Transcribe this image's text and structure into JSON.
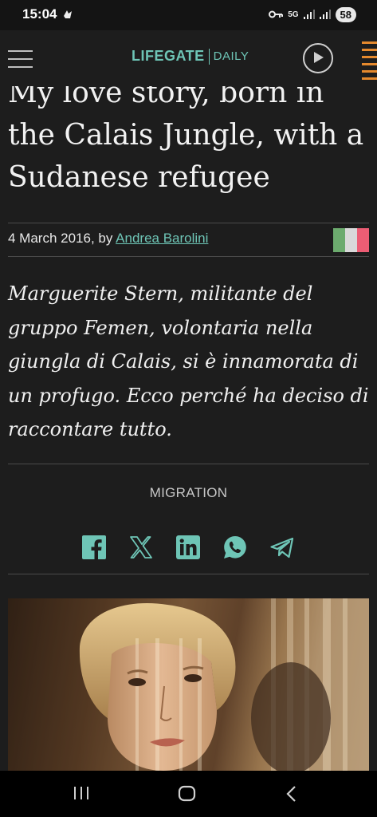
{
  "status_bar": {
    "time": "15:04",
    "network": "5G",
    "battery": "58"
  },
  "header": {
    "logo_main": "LIFEGATE",
    "logo_sub": "DAILY"
  },
  "article": {
    "title": "My love story, born in the Calais Jungle, with a Sudanese refugee",
    "date": "4 March 2016, by",
    "author": "Andrea Barolini",
    "lead": "Marguerite Stern, militante del gruppo Femen, volontaria nella giungla di Calais, si è innamorata di un profugo. Ecco perché ha deciso di raccontare tutto.",
    "category": "MIGRATION"
  },
  "share": [
    "facebook-icon",
    "x-icon",
    "linkedin-icon",
    "whatsapp-icon",
    "telegram-icon"
  ],
  "colors": {
    "accent": "#6ec5b6",
    "background": "#1d1d1d",
    "orange_decoration": "#e5892d",
    "flag": [
      "#6cab6e",
      "#d9d9d9",
      "#ec5d74"
    ]
  }
}
